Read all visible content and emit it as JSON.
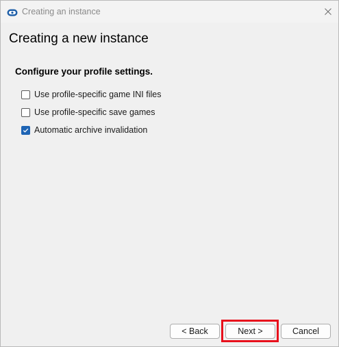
{
  "window": {
    "title": "Creating an instance",
    "close_icon": "close-icon",
    "app_icon": "app-logo-icon"
  },
  "page": {
    "title": "Creating a new instance",
    "section_heading": "Configure your profile settings."
  },
  "options": [
    {
      "label": "Use profile-specific game INI files",
      "checked": false
    },
    {
      "label": "Use profile-specific save games",
      "checked": false
    },
    {
      "label": "Automatic archive invalidation",
      "checked": true
    }
  ],
  "buttons": {
    "back_label": "< Back",
    "next_label": "Next >",
    "cancel_label": "Cancel"
  },
  "colors": {
    "accent": "#1e64b4",
    "highlight": "#e8101c"
  }
}
